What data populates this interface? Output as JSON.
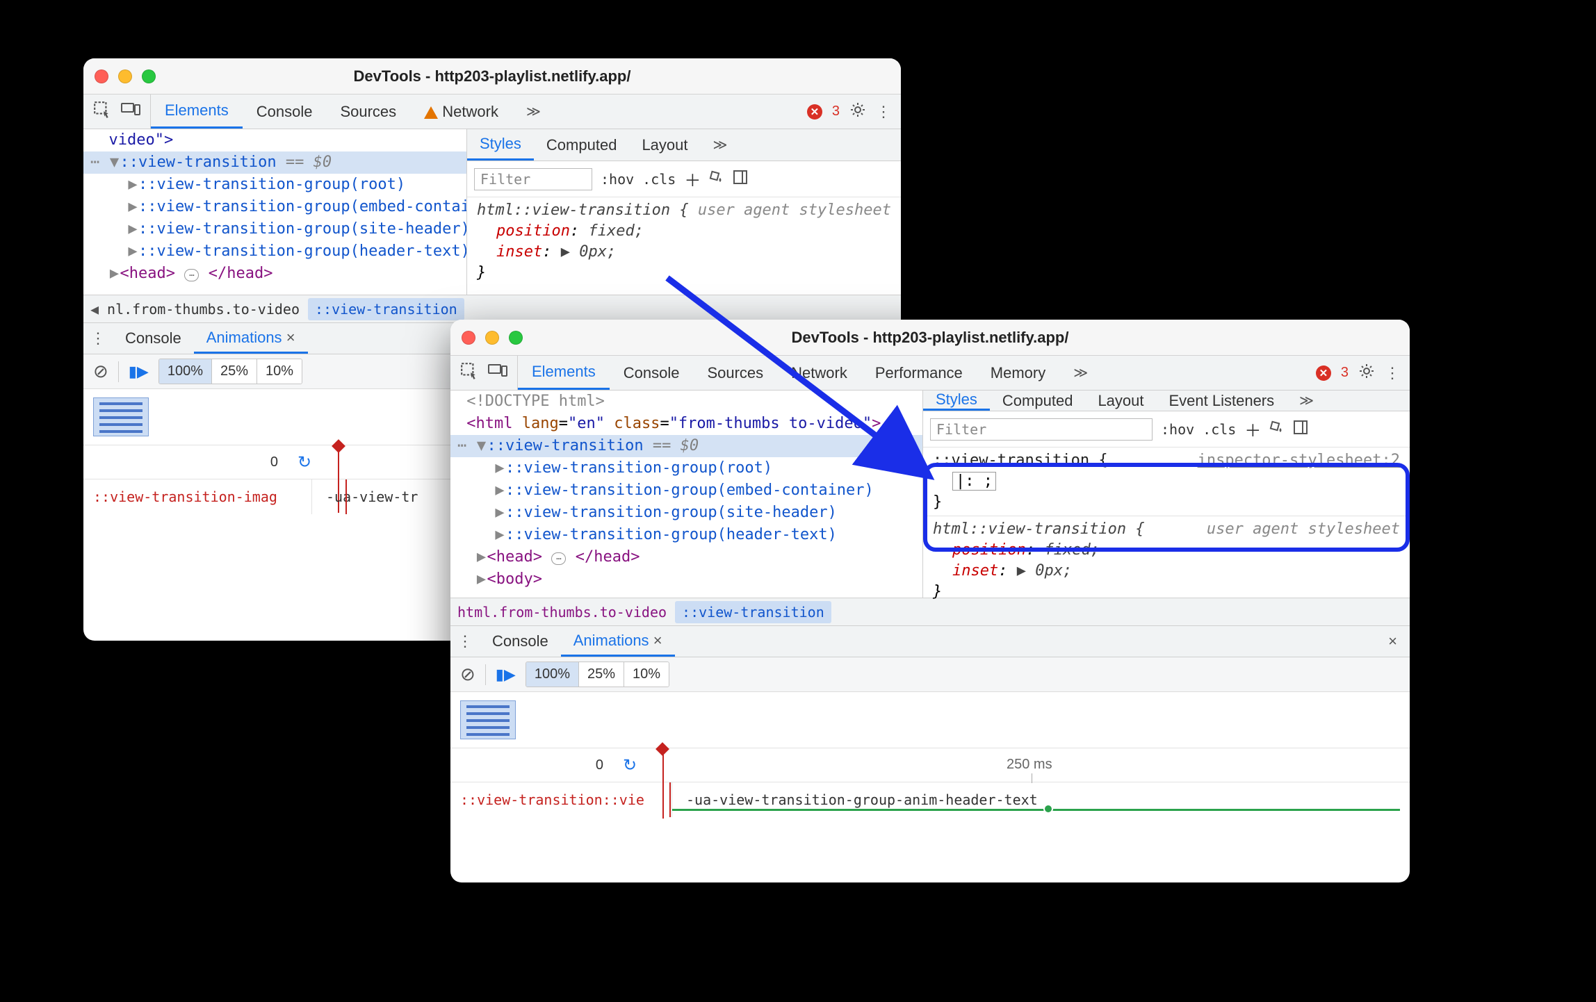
{
  "window1": {
    "title": "DevTools - http203-playlist.netlify.app/",
    "tabs": [
      "Elements",
      "Console",
      "Sources",
      "Network"
    ],
    "active_tab": "Elements",
    "error_count": "3",
    "tree_first": "video\">",
    "tree_sel": "::view-transition",
    "tree_sel_suffix": "== $0",
    "tree_groups": [
      "::view-transition-group(root)",
      "::view-transition-group(embed-container)",
      "::view-transition-group(site-header)",
      "::view-transition-group(header-text)"
    ],
    "tree_head_open": "<head>",
    "tree_head_close": "</head>",
    "tree_head_mid": "…",
    "styles_tabs": [
      "Styles",
      "Computed",
      "Layout"
    ],
    "styles_active": "Styles",
    "filter_placeholder": "Filter",
    "hov": ":hov",
    "cls": ".cls",
    "rule1_sel": "html::view-transition {",
    "rule1_src": "user agent stylesheet",
    "rule1_props": [
      {
        "n": "position",
        "v": "fixed;",
        "italic": true
      },
      {
        "n": "inset",
        "v": "▶ 0px;",
        "italic": true
      }
    ],
    "rule1_close": "}",
    "breadcrumb": [
      "nl.from-thumbs.to-video",
      "::view-transition"
    ],
    "drawer_tabs": [
      "Console",
      "Animations"
    ],
    "drawer_active": "Animations",
    "speeds": [
      "100%",
      "25%",
      "10%"
    ],
    "timeline_zero": "0",
    "track_label": "::view-transition-imag",
    "track_anim": "-ua-view-tr"
  },
  "window2": {
    "title": "DevTools - http203-playlist.netlify.app/",
    "tabs": [
      "Elements",
      "Console",
      "Sources",
      "Network",
      "Performance",
      "Memory"
    ],
    "active_tab": "Elements",
    "error_count": "3",
    "doctype": "<!DOCTYPE html>",
    "html_open_1": "<html ",
    "html_lang_attr": "lang",
    "html_lang_val": "\"en\"",
    "html_class_attr": "class",
    "html_class_val": "\"from-thumbs to-video\"",
    "html_open_2": ">",
    "tree_sel": "::view-transition",
    "tree_sel_suffix": "== $0",
    "tree_groups": [
      "::view-transition-group(root)",
      "::view-transition-group(embed-container)",
      "::view-transition-group(site-header)",
      "::view-transition-group(header-text)"
    ],
    "tree_head_open": "<head>",
    "tree_head_close": "</head>",
    "tree_head_mid": "…",
    "tree_body": "<body>",
    "styles_tabs": [
      "Styles",
      "Computed",
      "Layout",
      "Event Listeners"
    ],
    "styles_active": "Styles",
    "filter_placeholder": "Filter",
    "hov": ":hov",
    "cls": ".cls",
    "rule0_sel": "::view-transition {",
    "rule0_src": "inspector-stylesheet:2",
    "rule0_editing": "|:  ;",
    "rule0_close": "}",
    "rule1_sel": "html::view-transition {",
    "rule1_src": "user agent stylesheet",
    "rule1_props": [
      {
        "n": "position",
        "v": "fixed;",
        "italic": true
      },
      {
        "n": "inset",
        "v": "▶ 0px;",
        "italic": true
      }
    ],
    "rule1_close": "}",
    "breadcrumb": [
      "html.from-thumbs.to-video",
      "::view-transition"
    ],
    "drawer_tabs": [
      "Console",
      "Animations"
    ],
    "drawer_active": "Animations",
    "speeds": [
      "100%",
      "25%",
      "10%"
    ],
    "timeline_zero": "0",
    "timeline_mark": "250 ms",
    "track_label": "::view-transition::vie",
    "track_anim": "-ua-view-transition-group-anim-header-text"
  }
}
